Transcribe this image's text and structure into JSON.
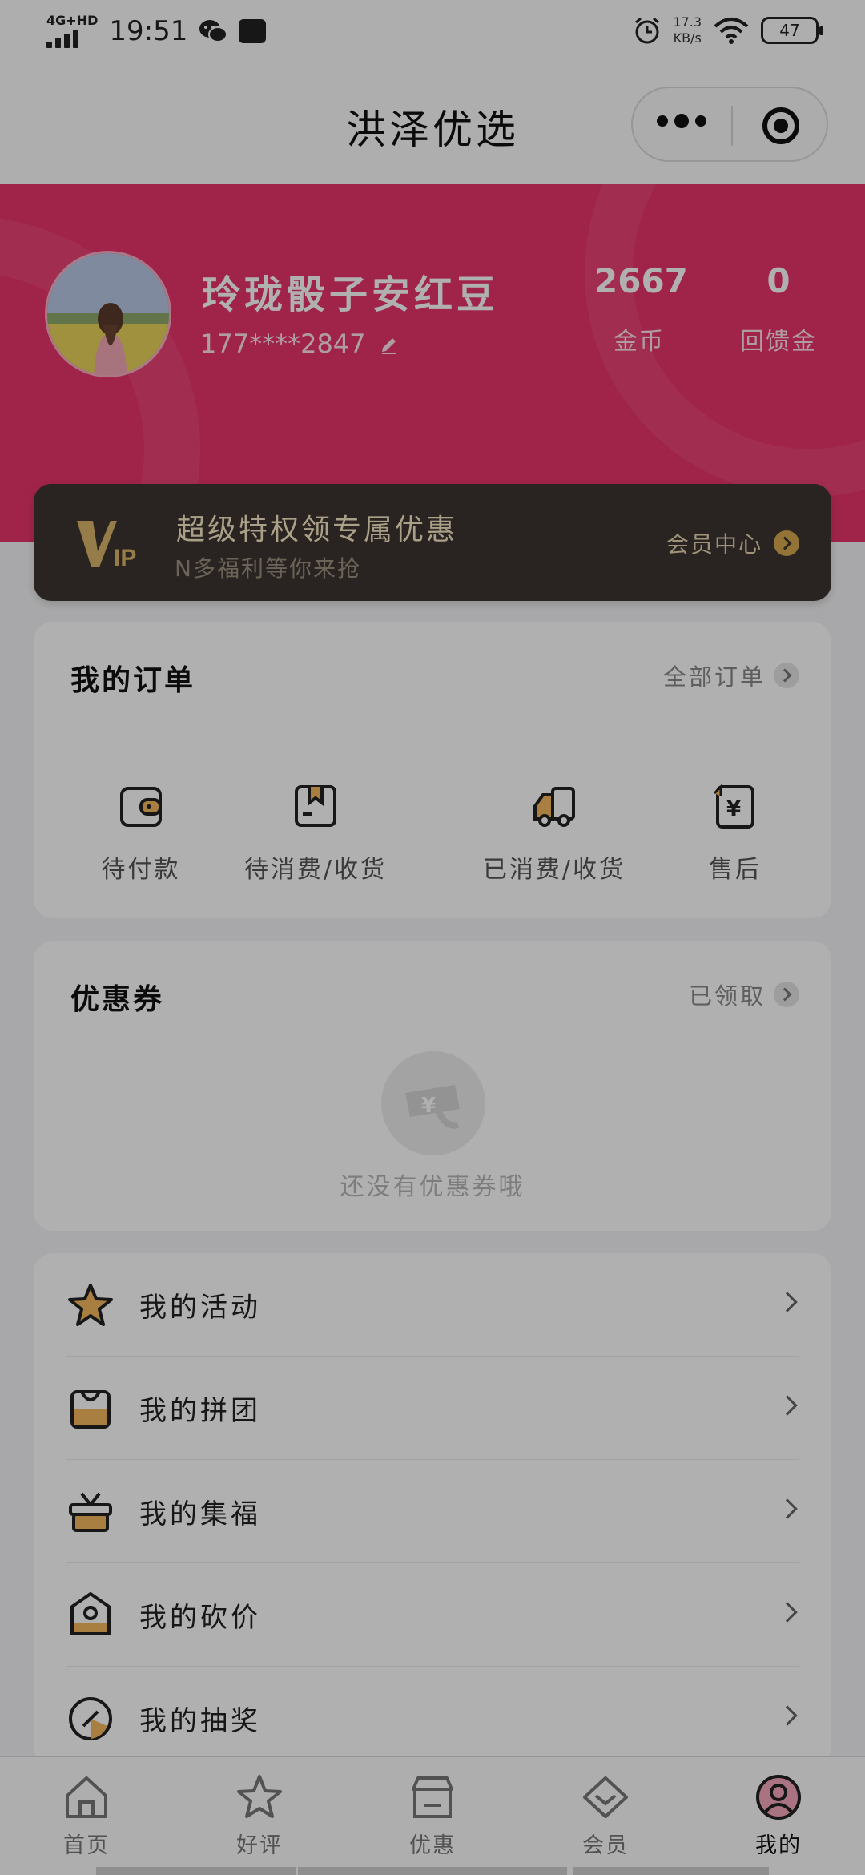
{
  "status_bar": {
    "network": "4G+HD",
    "time": "19:51",
    "speed_value": "17.3",
    "speed_unit": "KB/s",
    "battery": "47",
    "icons": [
      "signal-icon",
      "wechat-icon",
      "message-icon",
      "alarm-icon",
      "wifi-icon",
      "battery-icon"
    ]
  },
  "header": {
    "title": "洪泽优选",
    "capsule_icons": [
      "more-icon",
      "close-miniprogram-icon"
    ]
  },
  "profile": {
    "name": "玲珑骰子安红豆",
    "phone": "177****2847",
    "stats": [
      {
        "value": "2667",
        "label": "金币"
      },
      {
        "value": "0",
        "label": "回馈金"
      }
    ]
  },
  "vip": {
    "logo": "VIP",
    "title": "超级特权领专属优惠",
    "subtitle": "N多福利等你来抢",
    "link": "会员中心"
  },
  "orders": {
    "title": "我的订单",
    "link": "全部订单",
    "items": [
      {
        "label": "待付款",
        "icon": "wallet-icon"
      },
      {
        "label": "待消费/收货",
        "icon": "box-icon"
      },
      {
        "label": "已消费/收货",
        "icon": "truck-icon"
      },
      {
        "label": "售后",
        "icon": "refund-icon"
      }
    ]
  },
  "coupons": {
    "title": "优惠券",
    "link": "已领取",
    "empty_text": "还没有优惠券哦"
  },
  "menu": [
    {
      "label": "我的活动",
      "icon": "star-icon"
    },
    {
      "label": "我的拼团",
      "icon": "bag-icon"
    },
    {
      "label": "我的集福",
      "icon": "gift-icon"
    },
    {
      "label": "我的砍价",
      "icon": "price-tag-icon"
    },
    {
      "label": "我的抽奖",
      "icon": "lottery-icon"
    }
  ],
  "tabbar": [
    {
      "label": "首页",
      "icon": "home-icon"
    },
    {
      "label": "好评",
      "icon": "review-star-icon"
    },
    {
      "label": "优惠",
      "icon": "store-icon"
    },
    {
      "label": "会员",
      "icon": "diamond-icon"
    },
    {
      "label": "我的",
      "icon": "user-icon",
      "active": true
    }
  ],
  "colors": {
    "brand_pink": "#e8346b",
    "vip_dark": "#3c3530",
    "gold": "#d7a84f"
  }
}
